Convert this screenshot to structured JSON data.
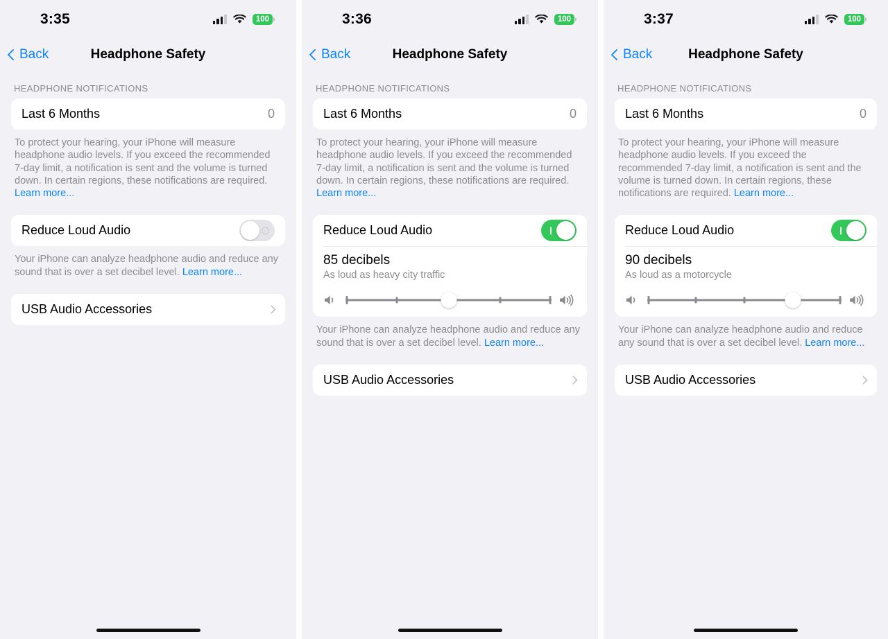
{
  "panels": [
    {
      "status": {
        "time": "3:35",
        "battery": "100",
        "signal_icon": "cellular-signal-icon",
        "wifi_icon": "wifi-icon",
        "battery_icon": "battery-icon"
      },
      "nav": {
        "back_label": "Back",
        "title": "Headphone Safety",
        "back_icon": "chevron-left-icon"
      },
      "section_header": "HEADPHONE NOTIFICATIONS",
      "notifications_row": {
        "label": "Last 6 Months",
        "value": "0"
      },
      "notifications_footnote": "To protect your hearing, your iPhone will measure headphone audio levels. If you exceed the recommended 7-day limit, a notification is sent and the volume is turned down. In certain regions, these notifications are required. ",
      "notifications_link": "Learn more...",
      "reduce_row": {
        "label": "Reduce Loud Audio",
        "toggle_state": "off"
      },
      "reduce_footnote": "Your iPhone can analyze headphone audio and reduce any sound that is over a set decibel level. ",
      "reduce_link": "Learn more...",
      "usb_row": {
        "label": "USB Audio Accessories",
        "chevron_icon": "chevron-right-icon"
      },
      "decibel": null
    },
    {
      "status": {
        "time": "3:36",
        "battery": "100",
        "signal_icon": "cellular-signal-icon",
        "wifi_icon": "wifi-icon",
        "battery_icon": "battery-icon"
      },
      "nav": {
        "back_label": "Back",
        "title": "Headphone Safety",
        "back_icon": "chevron-left-icon"
      },
      "section_header": "HEADPHONE NOTIFICATIONS",
      "notifications_row": {
        "label": "Last 6 Months",
        "value": "0"
      },
      "notifications_footnote": "To protect your hearing, your iPhone will measure headphone audio levels. If you exceed the recommended 7-day limit, a notification is sent and the volume is turned down. In certain regions, these notifications are required. ",
      "notifications_link": "Learn more...",
      "reduce_row": {
        "label": "Reduce Loud Audio",
        "toggle_state": "on"
      },
      "reduce_footnote": "Your iPhone can analyze headphone audio and reduce any sound that is over a set decibel level. ",
      "reduce_link": "Learn more...",
      "usb_row": {
        "label": "USB Audio Accessories",
        "chevron_icon": "chevron-right-icon"
      },
      "decibel": {
        "value_label": "85 decibels",
        "description": "As loud as heavy city traffic",
        "slider_position_index": 2,
        "slider_steps": 5,
        "slider_percent": 50,
        "low_icon": "volume-low-icon",
        "high_icon": "volume-high-icon"
      }
    },
    {
      "status": {
        "time": "3:37",
        "battery": "100",
        "signal_icon": "cellular-signal-icon",
        "wifi_icon": "wifi-icon",
        "battery_icon": "battery-icon"
      },
      "nav": {
        "back_label": "Back",
        "title": "Headphone Safety",
        "back_icon": "chevron-left-icon"
      },
      "section_header": "HEADPHONE NOTIFICATIONS",
      "notifications_row": {
        "label": "Last 6 Months",
        "value": "0"
      },
      "notifications_footnote": "To protect your hearing, your iPhone will measure headphone audio levels. If you exceed the recommended 7-day limit, a notification is sent and the volume is turned down. In certain regions, these notifications are required. ",
      "notifications_link": "Learn more...",
      "reduce_row": {
        "label": "Reduce Loud Audio",
        "toggle_state": "on"
      },
      "reduce_footnote": "Your iPhone can analyze headphone audio and reduce any sound that is over a set decibel level. ",
      "reduce_link": "Learn more...",
      "usb_row": {
        "label": "USB Audio Accessories",
        "chevron_icon": "chevron-right-icon"
      },
      "decibel": {
        "value_label": "90 decibels",
        "description": "As loud as a motorcycle",
        "slider_position_index": 3,
        "slider_steps": 5,
        "slider_percent": 75,
        "low_icon": "volume-low-icon",
        "high_icon": "volume-high-icon"
      }
    }
  ],
  "colors": {
    "accent_blue": "#0a84ff",
    "toggle_on_green": "#34c759",
    "battery_green": "#32c759",
    "background": "#f2f1f6",
    "card": "#ffffff",
    "secondary_text": "#8b8b90"
  }
}
